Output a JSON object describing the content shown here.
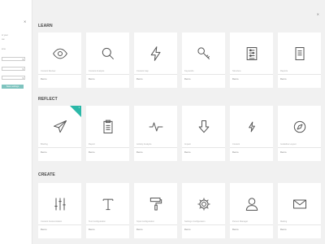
{
  "sidebar": {
    "close": "✕",
    "text1": "ct your",
    "text2": "ow.",
    "text3": "ions",
    "select_arrow": "▾",
    "button": "Save settings"
  },
  "main": {
    "close": "✕"
  },
  "sections": [
    {
      "title": "LEARN",
      "cards": [
        {
          "icon": "eye-icon",
          "title": "Content Review",
          "demo": "Demo"
        },
        {
          "icon": "search-icon",
          "title": "Content Analysis",
          "demo": "Demo"
        },
        {
          "icon": "lightning-icon",
          "title": "Content Gap",
          "demo": "Demo"
        },
        {
          "icon": "key-icon",
          "title": "Keywords",
          "demo": "Demo"
        },
        {
          "icon": "sliders-list-icon",
          "title": "Structure",
          "demo": "Demo"
        },
        {
          "icon": "document-icon",
          "title": "Reports",
          "demo": "Demo"
        }
      ]
    },
    {
      "title": "REFLECT",
      "cards": [
        {
          "icon": "paper-plane-icon",
          "title": "Briefing",
          "demo": "Demo",
          "badge": "1"
        },
        {
          "icon": "clipboard-icon",
          "title": "Report",
          "demo": "Demo"
        },
        {
          "icon": "pulse-icon",
          "title": "Activity Analysis",
          "demo": "Demo"
        },
        {
          "icon": "arrow-down-icon",
          "title": "Impact",
          "demo": "Demo"
        },
        {
          "icon": "bolt-small-icon",
          "title": "Content",
          "demo": "Demo"
        },
        {
          "icon": "compass-icon",
          "title": "Guideline Layout",
          "demo": "Demo"
        }
      ]
    },
    {
      "title": "CREATE",
      "cards": [
        {
          "icon": "equalizer-icon",
          "title": "Content Customization",
          "demo": "Demo"
        },
        {
          "icon": "text-type-icon",
          "title": "Text Configuration",
          "demo": "Demo"
        },
        {
          "icon": "paint-roller-icon",
          "title": "Style Configuration",
          "demo": "Demo"
        },
        {
          "icon": "settings-gear-icon",
          "title": "Settings Configuration",
          "demo": "Demo"
        },
        {
          "icon": "user-icon",
          "title": "Person Manager",
          "demo": "Demo"
        },
        {
          "icon": "mail-icon",
          "title": "Mailing",
          "demo": "Demo"
        }
      ]
    }
  ]
}
